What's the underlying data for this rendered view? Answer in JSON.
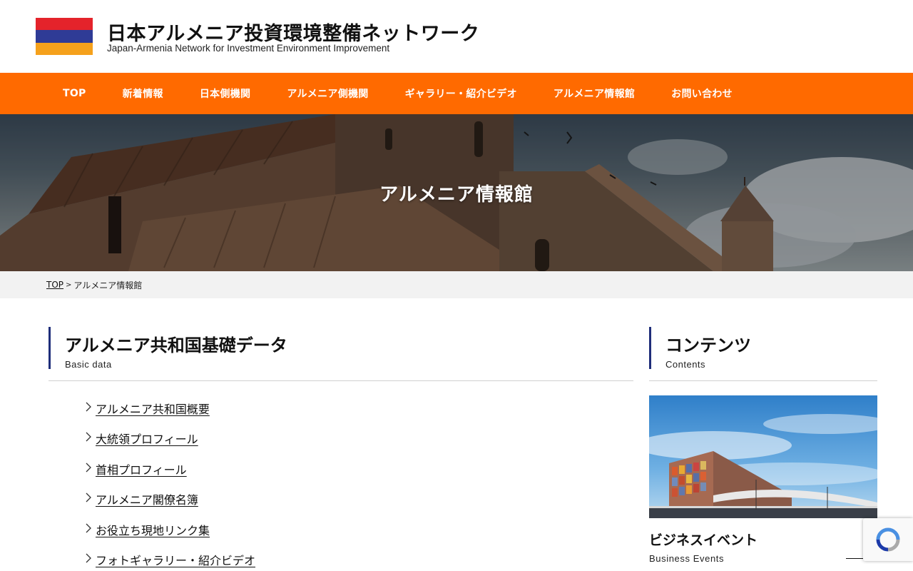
{
  "site": {
    "title": "日本アルメニア投資環境整備ネットワーク",
    "subtitle": "Japan-Armenia Network for Investment Environment Improvement"
  },
  "colors": {
    "brand_orange": "#ff6a00",
    "accent_navy": "#1f2e7a",
    "flag_red": "#e4232b",
    "flag_blue": "#2f3b96",
    "flag_orange": "#f5a11c"
  },
  "nav": {
    "items": [
      {
        "label": "TOP"
      },
      {
        "label": "新着情報"
      },
      {
        "label": "日本側機関"
      },
      {
        "label": "アルメニア側機関"
      },
      {
        "label": "ギャラリー・紹介ビデオ"
      },
      {
        "label": "アルメニア情報館"
      },
      {
        "label": "お問い合わせ"
      }
    ]
  },
  "hero": {
    "title": "アルメニア情報館"
  },
  "breadcrumb": {
    "home": "TOP",
    "separator": ">",
    "current": "アルメニア情報館"
  },
  "main": {
    "title": "アルメニア共和国基礎データ",
    "subtitle": "Basic data",
    "links": [
      {
        "label": "アルメニア共和国概要"
      },
      {
        "label": "大統領プロフィール"
      },
      {
        "label": "首相プロフィール"
      },
      {
        "label": "アルメニア閣僚名簿"
      },
      {
        "label": "お役立ち現地リンク集"
      },
      {
        "label": "フォトギャラリー・紹介ビデオ"
      }
    ]
  },
  "sidebar": {
    "title": "コンテンツ",
    "subtitle": "Contents",
    "card": {
      "title": "ビジネスイベント",
      "subtitle": "Business Events"
    }
  },
  "icons": {
    "flag": "armenia-flag-icon",
    "chevron": "chevron-right-icon",
    "recaptcha": "recaptcha-icon"
  }
}
